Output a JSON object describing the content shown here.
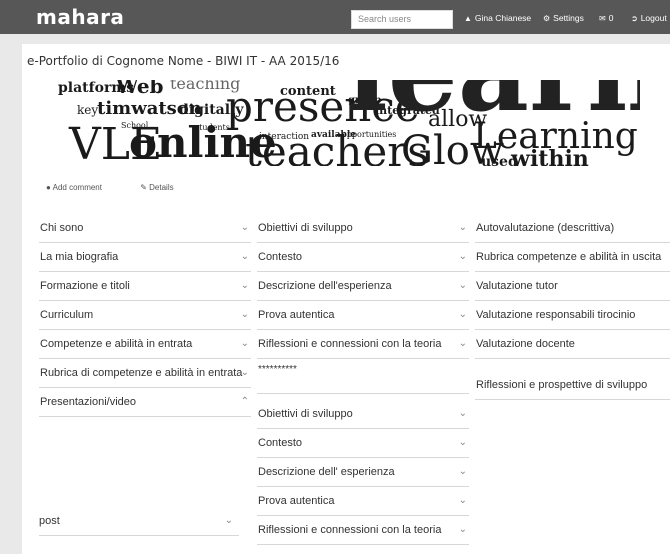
{
  "header": {
    "logo": "mahara",
    "search_placeholder": "Search users",
    "user": "Gina Chianese",
    "settings": "Settings",
    "inbox_count": "0",
    "logout": "Logout"
  },
  "page": {
    "title": "e-Portfolio di Cognome Nome - BIWI IT - AA 2015/16",
    "banner_words": [
      "platforms",
      "Web",
      "teaching",
      "content",
      "key",
      "timwatson",
      "digitally",
      "presence",
      "group",
      "integrated",
      "allow",
      "Learning",
      "VLE",
      "online",
      "teachers",
      "Glow",
      "used",
      "within",
      "interaction",
      "available",
      "opportunities",
      "students",
      "School"
    ]
  },
  "actions": {
    "add_comment": "Add comment",
    "details": "Details"
  },
  "columns": {
    "left": [
      "Chi sono",
      "La mia biografia",
      "Formazione e titoli",
      "Curriculum",
      "Competenze e abilità in entrata",
      "Rubrica di competenze e abilità in entrata",
      "Presentazioni/video"
    ],
    "left_post": "post",
    "middle_top": [
      "Obiettivi di sviluppo",
      "Contesto",
      "Descrizione dell'esperienza",
      "Prova autentica",
      "Riflessioni e connessioni con la teoria"
    ],
    "middle_stars": "**********",
    "middle_bottom": [
      "Obiettivi di sviluppo",
      "Contesto",
      "Descrizione dell' esperienza",
      "Prova autentica",
      "Riflessioni e connessioni con la teoria"
    ],
    "right": [
      "Autovalutazione (descrittiva)",
      "Rubrica competenze e abilità in uscita",
      "Valutazione tutor",
      "Valutazione responsabili tirocinio",
      "Valutazione docente"
    ],
    "right_extra": "Riflessioni e prospettive di sviluppo"
  }
}
